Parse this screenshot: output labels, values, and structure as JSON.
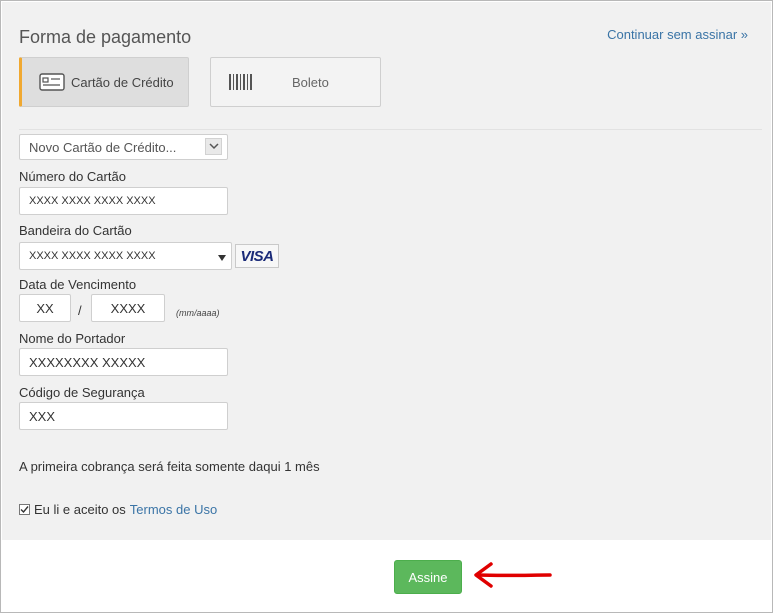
{
  "header": {
    "title": "Forma de pagamento",
    "skip_link": "Continuar sem assinar »"
  },
  "tabs": [
    {
      "label": "Cartão de Crédito",
      "icon": "credit-card-icon",
      "active": true
    },
    {
      "label": "Boleto",
      "icon": "barcode-icon",
      "active": false
    }
  ],
  "form": {
    "card_select": "Novo Cartão de Crédito...",
    "card_number": {
      "label": "Número do Cartão",
      "value": "XXXX XXXX XXXX XXXX"
    },
    "brand": {
      "label": "Bandeira do Cartão",
      "value": "XXXX XXXX XXXX XXXX",
      "logo": "VISA"
    },
    "expiry": {
      "label": "Data de Vencimento",
      "month": "XX",
      "separator": "/",
      "year": "XXXX",
      "hint": "(mm/aaaa)"
    },
    "holder": {
      "label": "Nome do Portador",
      "value": "XXXXXXXX XXXXX"
    },
    "cvv": {
      "label": "Código de Segurança",
      "value": "XXX"
    }
  },
  "note": "A primeira cobrança será feita somente daqui 1 mês",
  "terms": {
    "text": "Eu li e aceito os",
    "link": "Termos de Uso",
    "checked": true
  },
  "submit": {
    "label": "Assine",
    "color": "#5cb85c"
  },
  "colors": {
    "accent": "#f0a830",
    "link": "#3a74a6",
    "annotation_arrow": "#e00000"
  }
}
